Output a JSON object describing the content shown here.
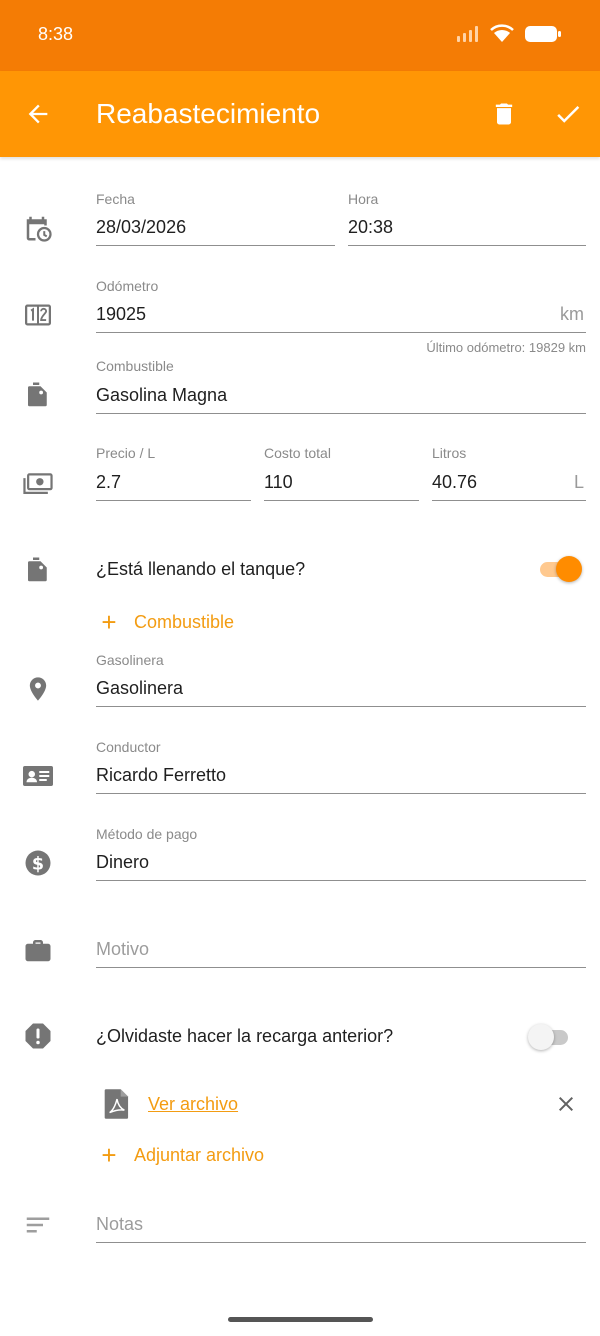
{
  "status_bar": {
    "time": "8:38"
  },
  "app_bar": {
    "title": "Reabastecimiento"
  },
  "date_row": {
    "fecha_label": "Fecha",
    "fecha_value": "28/03/2026",
    "hora_label": "Hora",
    "hora_value": "20:38"
  },
  "odometer": {
    "label": "Odómetro",
    "value": "19025",
    "unit": "km",
    "hint": "Último odómetro: 19829 km"
  },
  "fuel": {
    "label": "Combustible",
    "value": "Gasolina Magna"
  },
  "pricing": {
    "price_label": "Precio / L",
    "price_value": "2.7",
    "total_label": "Costo total",
    "total_value": "110",
    "liters_label": "Litros",
    "liters_value": "40.76",
    "liters_unit": "L"
  },
  "full_tank": {
    "label": "¿Está llenando el tanque?",
    "checked": true
  },
  "add_fuel": {
    "label": "Combustible"
  },
  "station": {
    "label": "Gasolinera",
    "value": "Gasolinera"
  },
  "driver": {
    "label": "Conductor",
    "value": "Ricardo Ferretto"
  },
  "payment": {
    "label": "Método de pago",
    "value": "Dinero"
  },
  "reason": {
    "placeholder": "Motivo"
  },
  "forgot": {
    "label": "¿Olvidaste hacer la recarga anterior?",
    "checked": false
  },
  "attachment": {
    "link": "Ver archivo"
  },
  "attach_file": {
    "label": "Adjuntar archivo"
  },
  "notes": {
    "placeholder": "Notas"
  },
  "colors": {
    "status_bar": "#f47c05",
    "app_bar": "#ff9605",
    "accent": "#f39c12",
    "icon_gray": "#757575"
  }
}
